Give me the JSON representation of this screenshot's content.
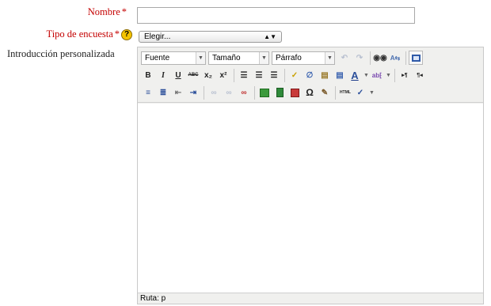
{
  "form": {
    "nombre": {
      "label": "Nombre",
      "required_mark": "*",
      "value": ""
    },
    "tipo": {
      "label": "Tipo de encuesta",
      "required_mark": "*",
      "selected": "Elegir...",
      "help_glyph": "?"
    },
    "intro": {
      "label": "Introducción personalizada"
    }
  },
  "editor": {
    "font_select": "Fuente",
    "size_select": "Tamaño",
    "format_select": "Párrafo",
    "status_path": "Ruta: p"
  },
  "icons": {
    "bold": "B",
    "italic": "I",
    "underline": "U",
    "strike": "ABC",
    "subscript": "x₂",
    "superscript": "x²",
    "text_color": "A",
    "html": "HTML",
    "special_char": "Ω",
    "ltr": "▸¶",
    "rtl": "¶◂"
  },
  "colors": {
    "required_label": "#c40000",
    "help_bg": "#f5c400",
    "toolbar_bg": "#f0f0ee"
  }
}
